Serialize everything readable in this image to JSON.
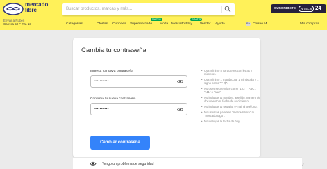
{
  "header": {
    "logo_text": [
      "mercado",
      "libre"
    ],
    "search_placeholder": "Buscar productos, marcas y más...",
    "promo_text": "SUSCRIBETE",
    "promo_badge": "NIVEL 6",
    "promo_number": "24",
    "location_line1": "Enviar a Ruben",
    "location_line2": "Carrera 53 F #2a-13",
    "nav": [
      "Categorías",
      "Ofertas",
      "Cupones",
      "Supermercado",
      "Moda",
      "Mercado Play",
      "Vender",
      "Ayuda"
    ],
    "nav_tags": {
      "supermercado": "NUEVO",
      "mercado_play": "GRATIS"
    },
    "account_short": "Correo M...",
    "purchases": "Mis compras",
    "avatar_initials": "RA"
  },
  "form": {
    "title": "Cambia tu contraseña",
    "new_label": "Ingresa tu nueva contraseña",
    "new_value": "••••••••••",
    "confirm_label": "Confirma tu nueva contraseña",
    "confirm_value": "••••••••••",
    "submit_label": "Cambiar contraseña"
  },
  "rules": [
    "Usa mínimo 8 caracteres con letras y números.",
    "Usa mínimo 1 mayúscula, 1 minúscula y 1 signo como \"!\" \"$\".",
    "No uses secuencias como \"123\", \"ABC\", \"111\" o \"aaa\".",
    "No incluyas tu nombre, apellido, número de documento ni fecha de nacimiento.",
    "No incluyas tu usuario, e-mail ni teléfono.",
    "No uses las palabras \"mercadolibre\" ni \"mercadopago\".",
    "No incluyas la fecha de hoy."
  ],
  "help": {
    "text": "Tengo un problema de seguridad"
  },
  "colors": {
    "header_bg": "#fff159",
    "primary_button": "#3483fa",
    "page_bg": "#ebebeb",
    "new_tag": "#00a650"
  }
}
